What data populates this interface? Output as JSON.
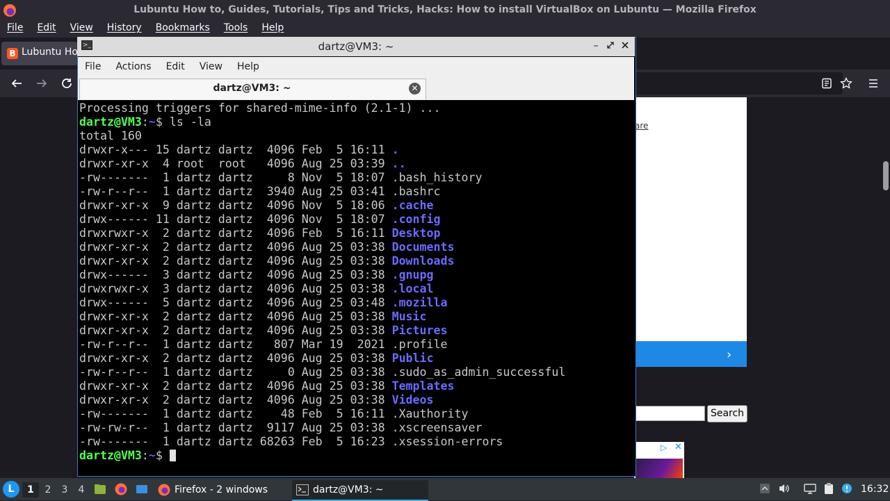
{
  "firefox": {
    "window_title": "Lubuntu How to, Guides, Tutorials, Tips and Tricks, Hacks: How to install VirtualBox on Lubuntu — Mozilla Firefox",
    "menu": [
      "File",
      "Edit",
      "View",
      "History",
      "Bookmarks",
      "Tools",
      "Help"
    ],
    "tab_label": "Lubuntu How to",
    "tab_favicon": "B",
    "page": {
      "link_fragment": "are",
      "search_button": "Search",
      "banner_chevron": "›",
      "ad_close": "✕",
      "ad_choice": "▷"
    }
  },
  "terminal": {
    "title": "dartz@VM3: ~",
    "menu": [
      "File",
      "Actions",
      "Edit",
      "View",
      "Help"
    ],
    "tab_label": "dartz@VM3: ~",
    "prompt_user": "dartz@VM3",
    "prompt_path": "~",
    "lines": [
      {
        "text": "Processing triggers for shared-mime-info (2.1-1) ..."
      },
      {
        "prompt": true,
        "cmd": "ls -la"
      },
      {
        "text": "total 160"
      },
      {
        "perm": "drwxr-x---",
        "links": "15",
        "owner": "dartz",
        "group": "dartz",
        "size": "4096",
        "date": "Feb  5 16:11",
        "name": ".",
        "dir": true
      },
      {
        "perm": "drwxr-xr-x",
        "links": "4",
        "owner": "root",
        "group": "root",
        "size": "4096",
        "date": "Aug 25 03:39",
        "name": "..",
        "dir": true
      },
      {
        "perm": "-rw-------",
        "links": "1",
        "owner": "dartz",
        "group": "dartz",
        "size": "8",
        "date": "Nov  5 18:07",
        "name": ".bash_history",
        "dir": false
      },
      {
        "perm": "-rw-r--r--",
        "links": "1",
        "owner": "dartz",
        "group": "dartz",
        "size": "3940",
        "date": "Aug 25 03:41",
        "name": ".bashrc",
        "dir": false
      },
      {
        "perm": "drwxr-xr-x",
        "links": "9",
        "owner": "dartz",
        "group": "dartz",
        "size": "4096",
        "date": "Nov  5 18:06",
        "name": ".cache",
        "dir": true
      },
      {
        "perm": "drwx------",
        "links": "11",
        "owner": "dartz",
        "group": "dartz",
        "size": "4096",
        "date": "Nov  5 18:07",
        "name": ".config",
        "dir": true
      },
      {
        "perm": "drwxrwxr-x",
        "links": "2",
        "owner": "dartz",
        "group": "dartz",
        "size": "4096",
        "date": "Feb  5 16:11",
        "name": "Desktop",
        "dir": true
      },
      {
        "perm": "drwxr-xr-x",
        "links": "2",
        "owner": "dartz",
        "group": "dartz",
        "size": "4096",
        "date": "Aug 25 03:38",
        "name": "Documents",
        "dir": true
      },
      {
        "perm": "drwxr-xr-x",
        "links": "2",
        "owner": "dartz",
        "group": "dartz",
        "size": "4096",
        "date": "Aug 25 03:38",
        "name": "Downloads",
        "dir": true
      },
      {
        "perm": "drwx------",
        "links": "3",
        "owner": "dartz",
        "group": "dartz",
        "size": "4096",
        "date": "Aug 25 03:38",
        "name": ".gnupg",
        "dir": true
      },
      {
        "perm": "drwxrwxr-x",
        "links": "3",
        "owner": "dartz",
        "group": "dartz",
        "size": "4096",
        "date": "Aug 25 03:38",
        "name": ".local",
        "dir": true
      },
      {
        "perm": "drwx------",
        "links": "5",
        "owner": "dartz",
        "group": "dartz",
        "size": "4096",
        "date": "Aug 25 03:48",
        "name": ".mozilla",
        "dir": true
      },
      {
        "perm": "drwxr-xr-x",
        "links": "2",
        "owner": "dartz",
        "group": "dartz",
        "size": "4096",
        "date": "Aug 25 03:38",
        "name": "Music",
        "dir": true
      },
      {
        "perm": "drwxr-xr-x",
        "links": "2",
        "owner": "dartz",
        "group": "dartz",
        "size": "4096",
        "date": "Aug 25 03:38",
        "name": "Pictures",
        "dir": true
      },
      {
        "perm": "-rw-r--r--",
        "links": "1",
        "owner": "dartz",
        "group": "dartz",
        "size": "807",
        "date": "Mar 19  2021",
        "name": ".profile",
        "dir": false
      },
      {
        "perm": "drwxr-xr-x",
        "links": "2",
        "owner": "dartz",
        "group": "dartz",
        "size": "4096",
        "date": "Aug 25 03:38",
        "name": "Public",
        "dir": true
      },
      {
        "perm": "-rw-r--r--",
        "links": "1",
        "owner": "dartz",
        "group": "dartz",
        "size": "0",
        "date": "Aug 25 03:38",
        "name": ".sudo_as_admin_successful",
        "dir": false
      },
      {
        "perm": "drwxr-xr-x",
        "links": "2",
        "owner": "dartz",
        "group": "dartz",
        "size": "4096",
        "date": "Aug 25 03:38",
        "name": "Templates",
        "dir": true
      },
      {
        "perm": "drwxr-xr-x",
        "links": "2",
        "owner": "dartz",
        "group": "dartz",
        "size": "4096",
        "date": "Aug 25 03:38",
        "name": "Videos",
        "dir": true
      },
      {
        "perm": "-rw-------",
        "links": "1",
        "owner": "dartz",
        "group": "dartz",
        "size": "48",
        "date": "Feb  5 16:11",
        "name": ".Xauthority",
        "dir": false
      },
      {
        "perm": "-rw-rw-r--",
        "links": "1",
        "owner": "dartz",
        "group": "dartz",
        "size": "9117",
        "date": "Aug 25 03:38",
        "name": ".xscreensaver",
        "dir": false
      },
      {
        "perm": "-rw-------",
        "links": "1",
        "owner": "dartz",
        "group": "dartz",
        "size": "68263",
        "date": "Feb  5 16:23",
        "name": ".xsession-errors",
        "dir": false
      },
      {
        "prompt": true,
        "cmd": "",
        "cursor": true
      }
    ]
  },
  "taskbar": {
    "workspaces": [
      "1",
      "2",
      "3",
      "4"
    ],
    "active_workspace": "1",
    "tasks": [
      {
        "label": "Firefox - 2 windows",
        "icon": "firefox-icon"
      },
      {
        "label": "dartz@VM3: ~",
        "icon": "terminal-icon"
      }
    ],
    "clock": "16:32"
  },
  "colors": {
    "prompt_green": "#54ff54",
    "dir_blue": "#6b6bff",
    "terminal_bg": "#000000",
    "taskbar_bg": "#31363b",
    "window_border": "#3f76c5"
  }
}
